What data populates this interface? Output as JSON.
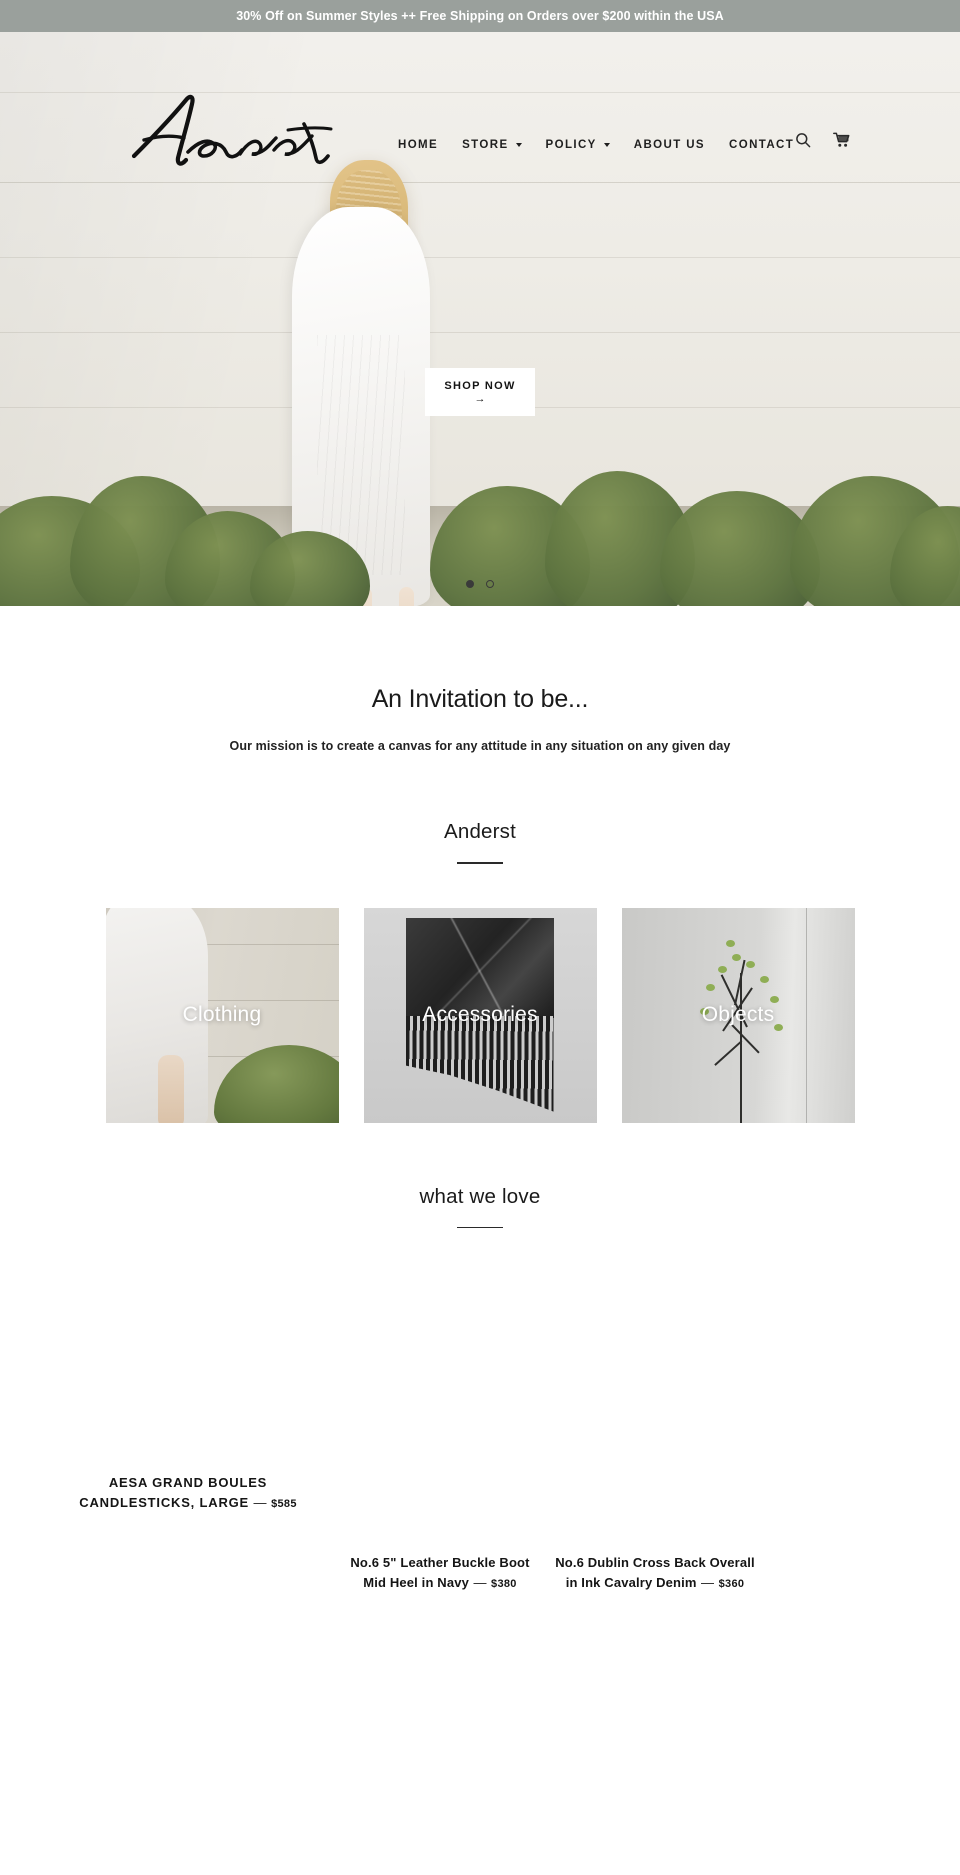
{
  "announcement": {
    "text": "30% Off on Summer Styles ++ Free Shipping on Orders over $200 within the USA"
  },
  "header": {
    "logo_alt": "Anderst",
    "nav": [
      {
        "label": "HOME",
        "has_dropdown": false
      },
      {
        "label": "STORE",
        "has_dropdown": true
      },
      {
        "label": "POLICY",
        "has_dropdown": true
      },
      {
        "label": "ABOUT US",
        "has_dropdown": false
      },
      {
        "label": "CONTACT",
        "has_dropdown": false
      }
    ],
    "icons": [
      {
        "name": "search-icon"
      },
      {
        "name": "cart-icon"
      }
    ]
  },
  "hero": {
    "cta_label": "SHOP NOW",
    "cta_arrow": "→",
    "slides": [
      {
        "active": true
      },
      {
        "active": false
      }
    ]
  },
  "mission": {
    "title": "An Invitation to be...",
    "subtitle": "Our mission is to create a canvas for any attitude in any situation on any given day"
  },
  "collections_section": {
    "title": "Anderst",
    "cards": [
      {
        "label": "Clothing"
      },
      {
        "label": "Accessories"
      },
      {
        "label": "Objects"
      }
    ]
  },
  "featured_section": {
    "title": "what we love",
    "products": [
      {
        "title_line1": "AESA GRAND BOULES",
        "title_line2": "CANDLESTICKS, LARGE",
        "separator": "—",
        "price": "$585"
      },
      {
        "title_line1": "No.6 5\" Leather Buckle Boot",
        "title_line2": "Mid Heel in Navy",
        "separator": "—",
        "price": "$380"
      },
      {
        "title_line1": "No.6 Dublin Cross Back Overall",
        "title_line2": "in Ink Cavalry Denim",
        "separator": "—",
        "price": "$360"
      }
    ]
  },
  "colors": {
    "announcement_bg": "#9aa09c",
    "text_dark": "#151515",
    "page_bg": "#ffffff"
  }
}
